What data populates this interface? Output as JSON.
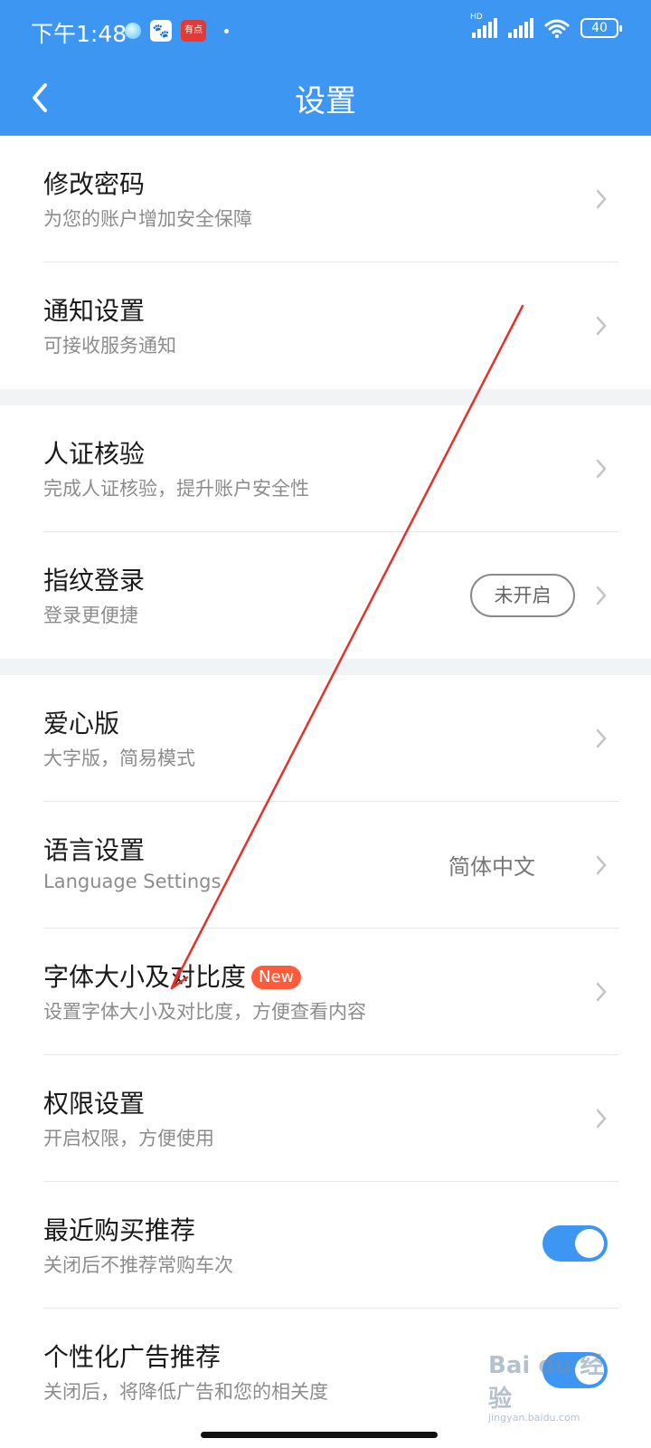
{
  "status_bar": {
    "time": "下午1:48",
    "app_icon_red_text": "有点",
    "signal_label": "HD",
    "battery": "40"
  },
  "header": {
    "title": "设置"
  },
  "groups": [
    {
      "items": [
        {
          "title": "修改密码",
          "subtitle": "为您的账户增加安全保障"
        },
        {
          "title": "通知设置",
          "subtitle": "可接收服务通知"
        }
      ]
    },
    {
      "items": [
        {
          "title": "人证核验",
          "subtitle": "完成人证核验，提升账户安全性"
        },
        {
          "title": "指纹登录",
          "subtitle": "登录更便捷",
          "status": "未开启"
        }
      ]
    },
    {
      "items": [
        {
          "title": "爱心版",
          "subtitle": "大字版，简易模式"
        },
        {
          "title": "语言设置",
          "subtitle": "Language Settings",
          "value": "简体中文"
        },
        {
          "title": "字体大小及对比度",
          "badge": "New",
          "subtitle": "设置字体大小及对比度，方便查看内容"
        },
        {
          "title": "权限设置",
          "subtitle": "开启权限，方便使用"
        },
        {
          "title": "最近购买推荐",
          "subtitle": "关闭后不推荐常购车次",
          "toggle_on": true
        },
        {
          "title": "个性化广告推荐",
          "subtitle": "关闭后，将降低广告和您的相关度",
          "toggle_on": true
        }
      ]
    }
  ],
  "watermark": {
    "brand": "Bai du 经验",
    "url": "jingyan.baidu.com"
  },
  "colors": {
    "primary": "#3d97f2",
    "badge": "#ff5b3a",
    "annotation_arrow": "#e8302a"
  }
}
